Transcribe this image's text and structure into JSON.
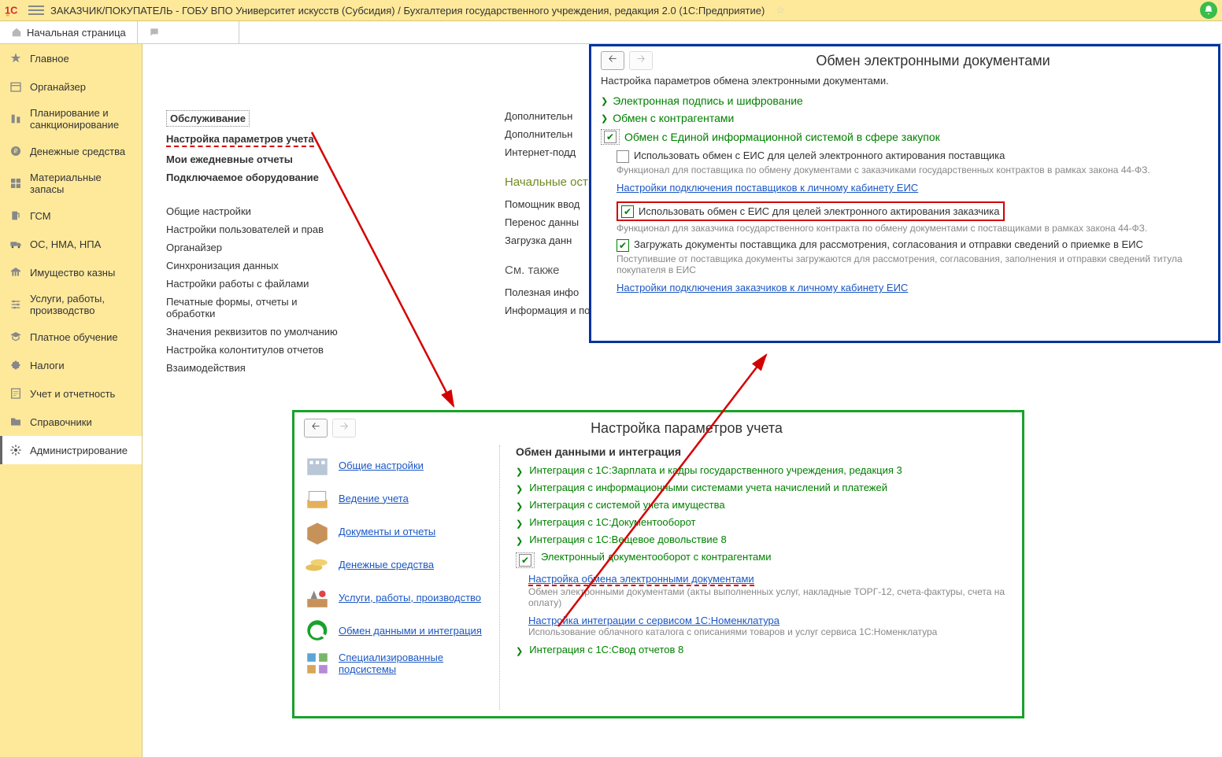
{
  "topbar": {
    "title": "ЗАКАЗЧИК/ПОКУПАТЕЛЬ - ГОБУ ВПО Университет искусств (Субсидия) / Бухгалтерия государственного учреждения, редакция 2.0  (1С:Предприятие)"
  },
  "tab": {
    "home": "Начальная страница"
  },
  "sidebar": {
    "items": [
      {
        "label": "Главное"
      },
      {
        "label": "Органайзер"
      },
      {
        "label": "Планирование и санкционирование"
      },
      {
        "label": "Денежные средства"
      },
      {
        "label": "Материальные запасы"
      },
      {
        "label": "ГСМ"
      },
      {
        "label": "ОС, НМА, НПА"
      },
      {
        "label": "Имущество казны"
      },
      {
        "label": "Услуги, работы, производство"
      },
      {
        "label": "Платное обучение"
      },
      {
        "label": "Налоги"
      },
      {
        "label": "Учет и отчетность"
      },
      {
        "label": "Справочники"
      },
      {
        "label": "Администрирование"
      }
    ]
  },
  "adminMenu": {
    "section1_header": "Обслуживание",
    "section1_item": "Настройка параметров учета",
    "items2": [
      "Мои ежедневные отчеты",
      "Подключаемое оборудование"
    ],
    "items3": [
      "Общие настройки",
      "Настройки пользователей и прав",
      "Органайзер",
      "Синхронизация данных",
      "Настройки работы с файлами",
      "Печатные формы, отчеты и обработки",
      "Значения реквизитов по умолчанию",
      "Настройка колонтитулов отчетов",
      "Взаимодействия"
    ]
  },
  "midCol": {
    "top": [
      "Дополнительн",
      "Дополнительн",
      "Интернет-подд"
    ],
    "hd1": "Начальные ост",
    "g1": [
      "Помощник ввод",
      "Перенос данны",
      "Загрузка данн"
    ],
    "hd2": "См. также",
    "g2": [
      "Полезная инфо",
      "Информация и поддержка"
    ]
  },
  "bluePanel": {
    "title": "Обмен электронными документами",
    "desc": "Настройка параметров обмена электронными документами.",
    "exp1": "Электронная подпись и шифрование",
    "exp2": "Обмен с контрагентами",
    "exp3": "Обмен с Единой информационной системой в сфере закупок",
    "chk1": "Использовать обмен с ЕИС для целей электронного актирования поставщика",
    "hint1": "Функционал для поставщика по обмену документами с заказчиками государственных контрактов в рамках закона 44-ФЗ.",
    "link1": "Настройки подключения поставщиков к личному кабинету ЕИС",
    "chk2": "Использовать обмен с ЕИС для целей электронного актирования заказчика",
    "hint2": "Функционал для заказчика государственного контракта по обмену документами с поставщиками в рамках закона 44-ФЗ.",
    "chk3": "Загружать документы поставщика для рассмотрения, согласования и отправки сведений о приемке в ЕИС",
    "hint3": "Поступившие от поставщика документы загружаются для рассмотрения, согласования, заполнения и отправки сведений титула покупателя в ЕИС",
    "link2": "Настройки подключения заказчиков к личному кабинету ЕИС"
  },
  "greenPanel": {
    "title": "Настройка параметров учета",
    "cats": [
      {
        "label": "Общие настройки"
      },
      {
        "label": "Ведение учета"
      },
      {
        "label": "Документы и отчеты"
      },
      {
        "label": "Денежные средства"
      },
      {
        "label": "Услуги, работы, производство"
      },
      {
        "label": "Обмен данными и интеграция"
      },
      {
        "label": "Специализированные подсистемы"
      }
    ],
    "sectionTitle": "Обмен данными и интеграция",
    "links": [
      "Интеграция с 1С:Зарплата и кадры государственного учреждения, редакция 3",
      "Интеграция с информационными системами учета начислений и платежей",
      "Интеграция с системой учета имущества",
      "Интеграция с 1С:Документооборот",
      "Интеграция с 1С:Вещевое довольствие 8"
    ],
    "edo": "Электронный документооборот с контрагентами",
    "edoLink": "Настройка обмена электронными документами",
    "edoHint": "Обмен электронными документами (акты выполненных услуг, накладные ТОРГ-12, счета-фактуры, счета на оплату)",
    "nomLink": "Настройка интеграции с сервисом 1С:Номенклатура",
    "nomHint": "Использование облачного каталога с описаниями товаров и услуг сервиса 1С:Номенклатура",
    "lastLink": "Интеграция с 1С:Свод отчетов 8"
  }
}
